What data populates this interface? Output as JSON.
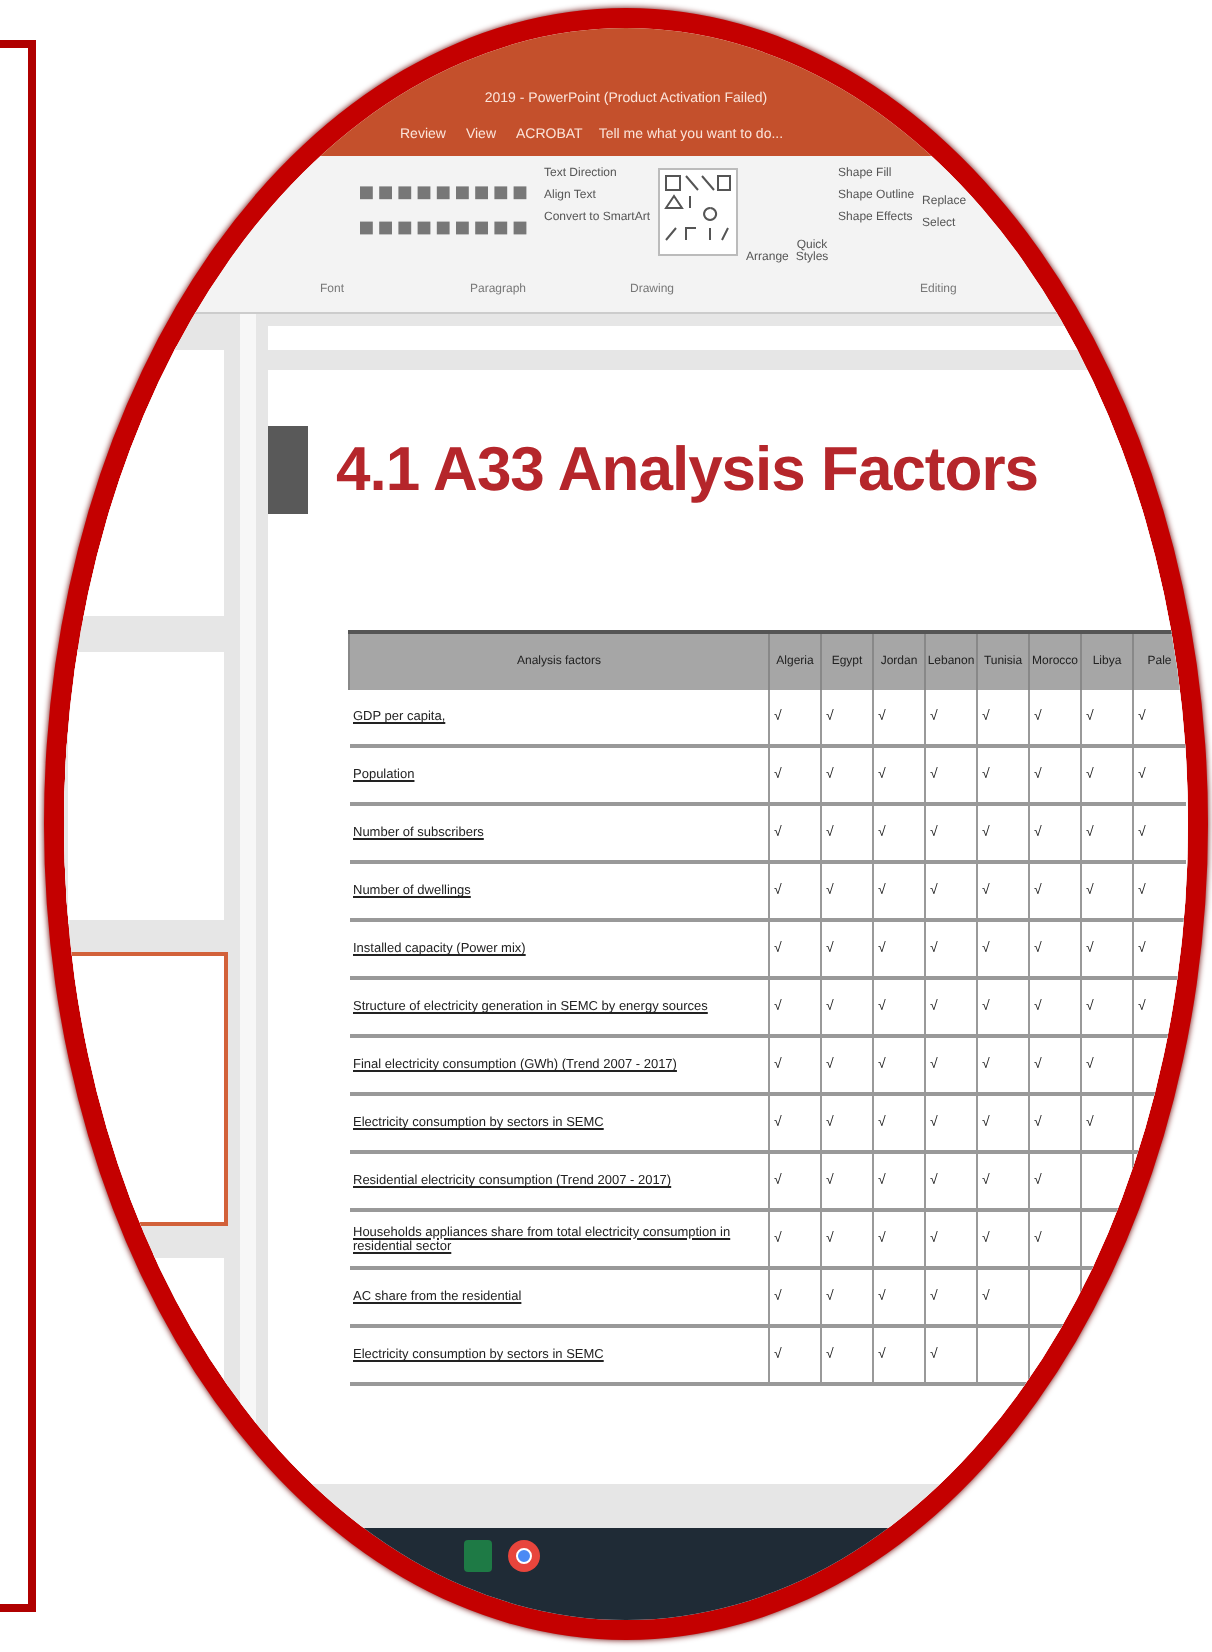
{
  "window": {
    "title": "2019 - PowerPoint (Product Activation Failed)"
  },
  "tabs": [
    {
      "label": "Review",
      "selected": false
    },
    {
      "label": "View",
      "selected": false
    },
    {
      "label": "ACROBAT",
      "selected": false
    }
  ],
  "tell_me": {
    "placeholder": "Tell me what you want to do..."
  },
  "ribbon": {
    "paragraph_tools": [
      "Text Direction",
      "Align Text",
      "Convert to SmartArt"
    ],
    "arrange": "Arrange",
    "quick_styles": "Quick Styles",
    "shape_tools": [
      "Shape Fill",
      "Shape Outline",
      "Shape Effects"
    ],
    "editing_tools": [
      "Replace",
      "Select"
    ],
    "groups": [
      "Font",
      "Paragraph",
      "Drawing",
      "Editing"
    ]
  },
  "thumbnails": [
    {
      "selected": false
    },
    {
      "selected": false
    },
    {
      "selected": true
    },
    {
      "selected": false
    }
  ],
  "slide": {
    "title": "4.1 A33 Analysis Factors",
    "table": {
      "columns": [
        "Analysis factors",
        "Algeria",
        "Egypt",
        "Jordan",
        "Lebanon",
        "Tunisia",
        "Morocco",
        "Libya",
        "Pale"
      ],
      "rows": [
        {
          "factor": "GDP per capita,",
          "checks": [
            "√",
            "√",
            "√",
            "√",
            "√",
            "√",
            "√",
            "√"
          ]
        },
        {
          "factor": "Population",
          "checks": [
            "√",
            "√",
            "√",
            "√",
            "√",
            "√",
            "√",
            "√"
          ]
        },
        {
          "factor": "Number of subscribers",
          "checks": [
            "√",
            "√",
            "√",
            "√",
            "√",
            "√",
            "√",
            "√"
          ]
        },
        {
          "factor": "Number of dwellings",
          "checks": [
            "√",
            "√",
            "√",
            "√",
            "√",
            "√",
            "√",
            "√"
          ]
        },
        {
          "factor": "Installed capacity (Power mix)",
          "checks": [
            "√",
            "√",
            "√",
            "√",
            "√",
            "√",
            "√",
            "√"
          ]
        },
        {
          "factor": "Structure of electricity generation in SEMC by energy sources",
          "checks": [
            "√",
            "√",
            "√",
            "√",
            "√",
            "√",
            "√",
            "√"
          ]
        },
        {
          "factor": "Final electricity consumption (GWh) (Trend 2007 - 2017)",
          "checks": [
            "√",
            "√",
            "√",
            "√",
            "√",
            "√",
            "√"
          ]
        },
        {
          "factor": "Electricity consumption by sectors in SEMC",
          "checks": [
            "√",
            "√",
            "√",
            "√",
            "√",
            "√",
            "√"
          ]
        },
        {
          "factor": "Residential electricity consumption (Trend 2007 - 2017)",
          "checks": [
            "√",
            "√",
            "√",
            "√",
            "√",
            "√"
          ]
        },
        {
          "factor": "Households appliances share from total electricity consumption in residential sector",
          "checks": [
            "√",
            "√",
            "√",
            "√",
            "√",
            "√"
          ]
        },
        {
          "factor": "AC share from the residential",
          "checks": [
            "√",
            "√",
            "√",
            "√",
            "√"
          ]
        },
        {
          "factor": "Electricity consumption by sectors in SEMC",
          "checks": [
            "√",
            "√",
            "√",
            "√"
          ]
        }
      ]
    }
  }
}
